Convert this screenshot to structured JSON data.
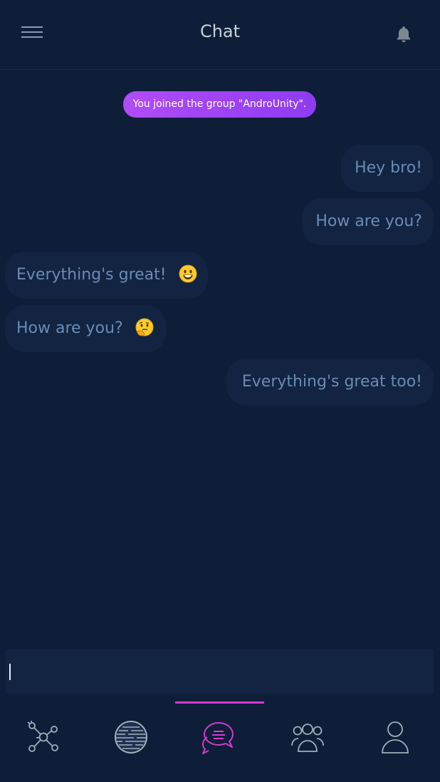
{
  "header": {
    "title": "Chat",
    "menu_icon": "hamburger-menu-icon",
    "notifications_icon": "bell-icon"
  },
  "system_message": "You joined the group \"AndroUnity\".",
  "messages": [
    {
      "direction": "outgoing",
      "text": "Hey bro!"
    },
    {
      "direction": "outgoing",
      "text": "How are you?"
    },
    {
      "direction": "incoming",
      "text": "Everything's great!",
      "emoji": "grinning-face-emoji"
    },
    {
      "direction": "incoming",
      "text": "How are you?",
      "emoji": "thinking-face-emoji"
    },
    {
      "direction": "outgoing",
      "text": "Everything's great too!"
    }
  ],
  "composer": {
    "value": "",
    "placeholder": ""
  },
  "bottom_nav": {
    "active": "chat",
    "items": [
      {
        "id": "network",
        "icon": "network-nodes-icon"
      },
      {
        "id": "globe",
        "icon": "globe-icon"
      },
      {
        "id": "chat",
        "icon": "chat-bubbles-icon"
      },
      {
        "id": "group",
        "icon": "group-people-icon"
      },
      {
        "id": "profile",
        "icon": "user-profile-icon"
      }
    ]
  },
  "colors": {
    "background": "#0e1e38",
    "bubble": "#122442",
    "bubble_text": "#6a8bb4",
    "pill_gradient_start": "#b14cf6",
    "pill_gradient_end": "#8d3cf2",
    "accent": "#d13bd0",
    "nav_icon": "#a3adbb",
    "header_title": "#c8cfd9"
  }
}
